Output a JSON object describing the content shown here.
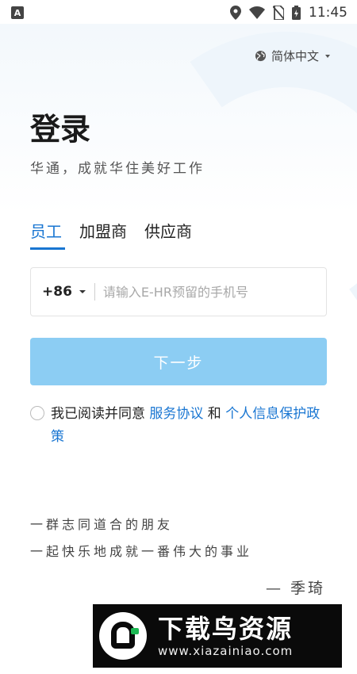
{
  "status_bar": {
    "badge": "A",
    "time": "11:45"
  },
  "language": {
    "label": "简体中文"
  },
  "login": {
    "title": "登录",
    "subtitle": "华通，成就华住美好工作"
  },
  "tabs": [
    {
      "label": "员工",
      "active": true
    },
    {
      "label": "加盟商",
      "active": false
    },
    {
      "label": "供应商",
      "active": false
    }
  ],
  "phone": {
    "country_code": "+86",
    "placeholder": "请输入E-HR预留的手机号",
    "value": ""
  },
  "next_button": {
    "label": "下一步"
  },
  "agreement": {
    "prefix": "我已阅读并同意 ",
    "service_link": "服务协议",
    "and": " 和 ",
    "privacy_link": "个人信息保护政策"
  },
  "quote": {
    "line1": "一群志同道合的朋友",
    "line2": "一起快乐地成就一番伟大的事业",
    "signature": "— 季琦"
  },
  "watermark": {
    "title": "下载鸟资源",
    "url": "www.xiazainiao.com"
  },
  "colors": {
    "accent": "#1976d2",
    "button": "#8ccdf3"
  }
}
